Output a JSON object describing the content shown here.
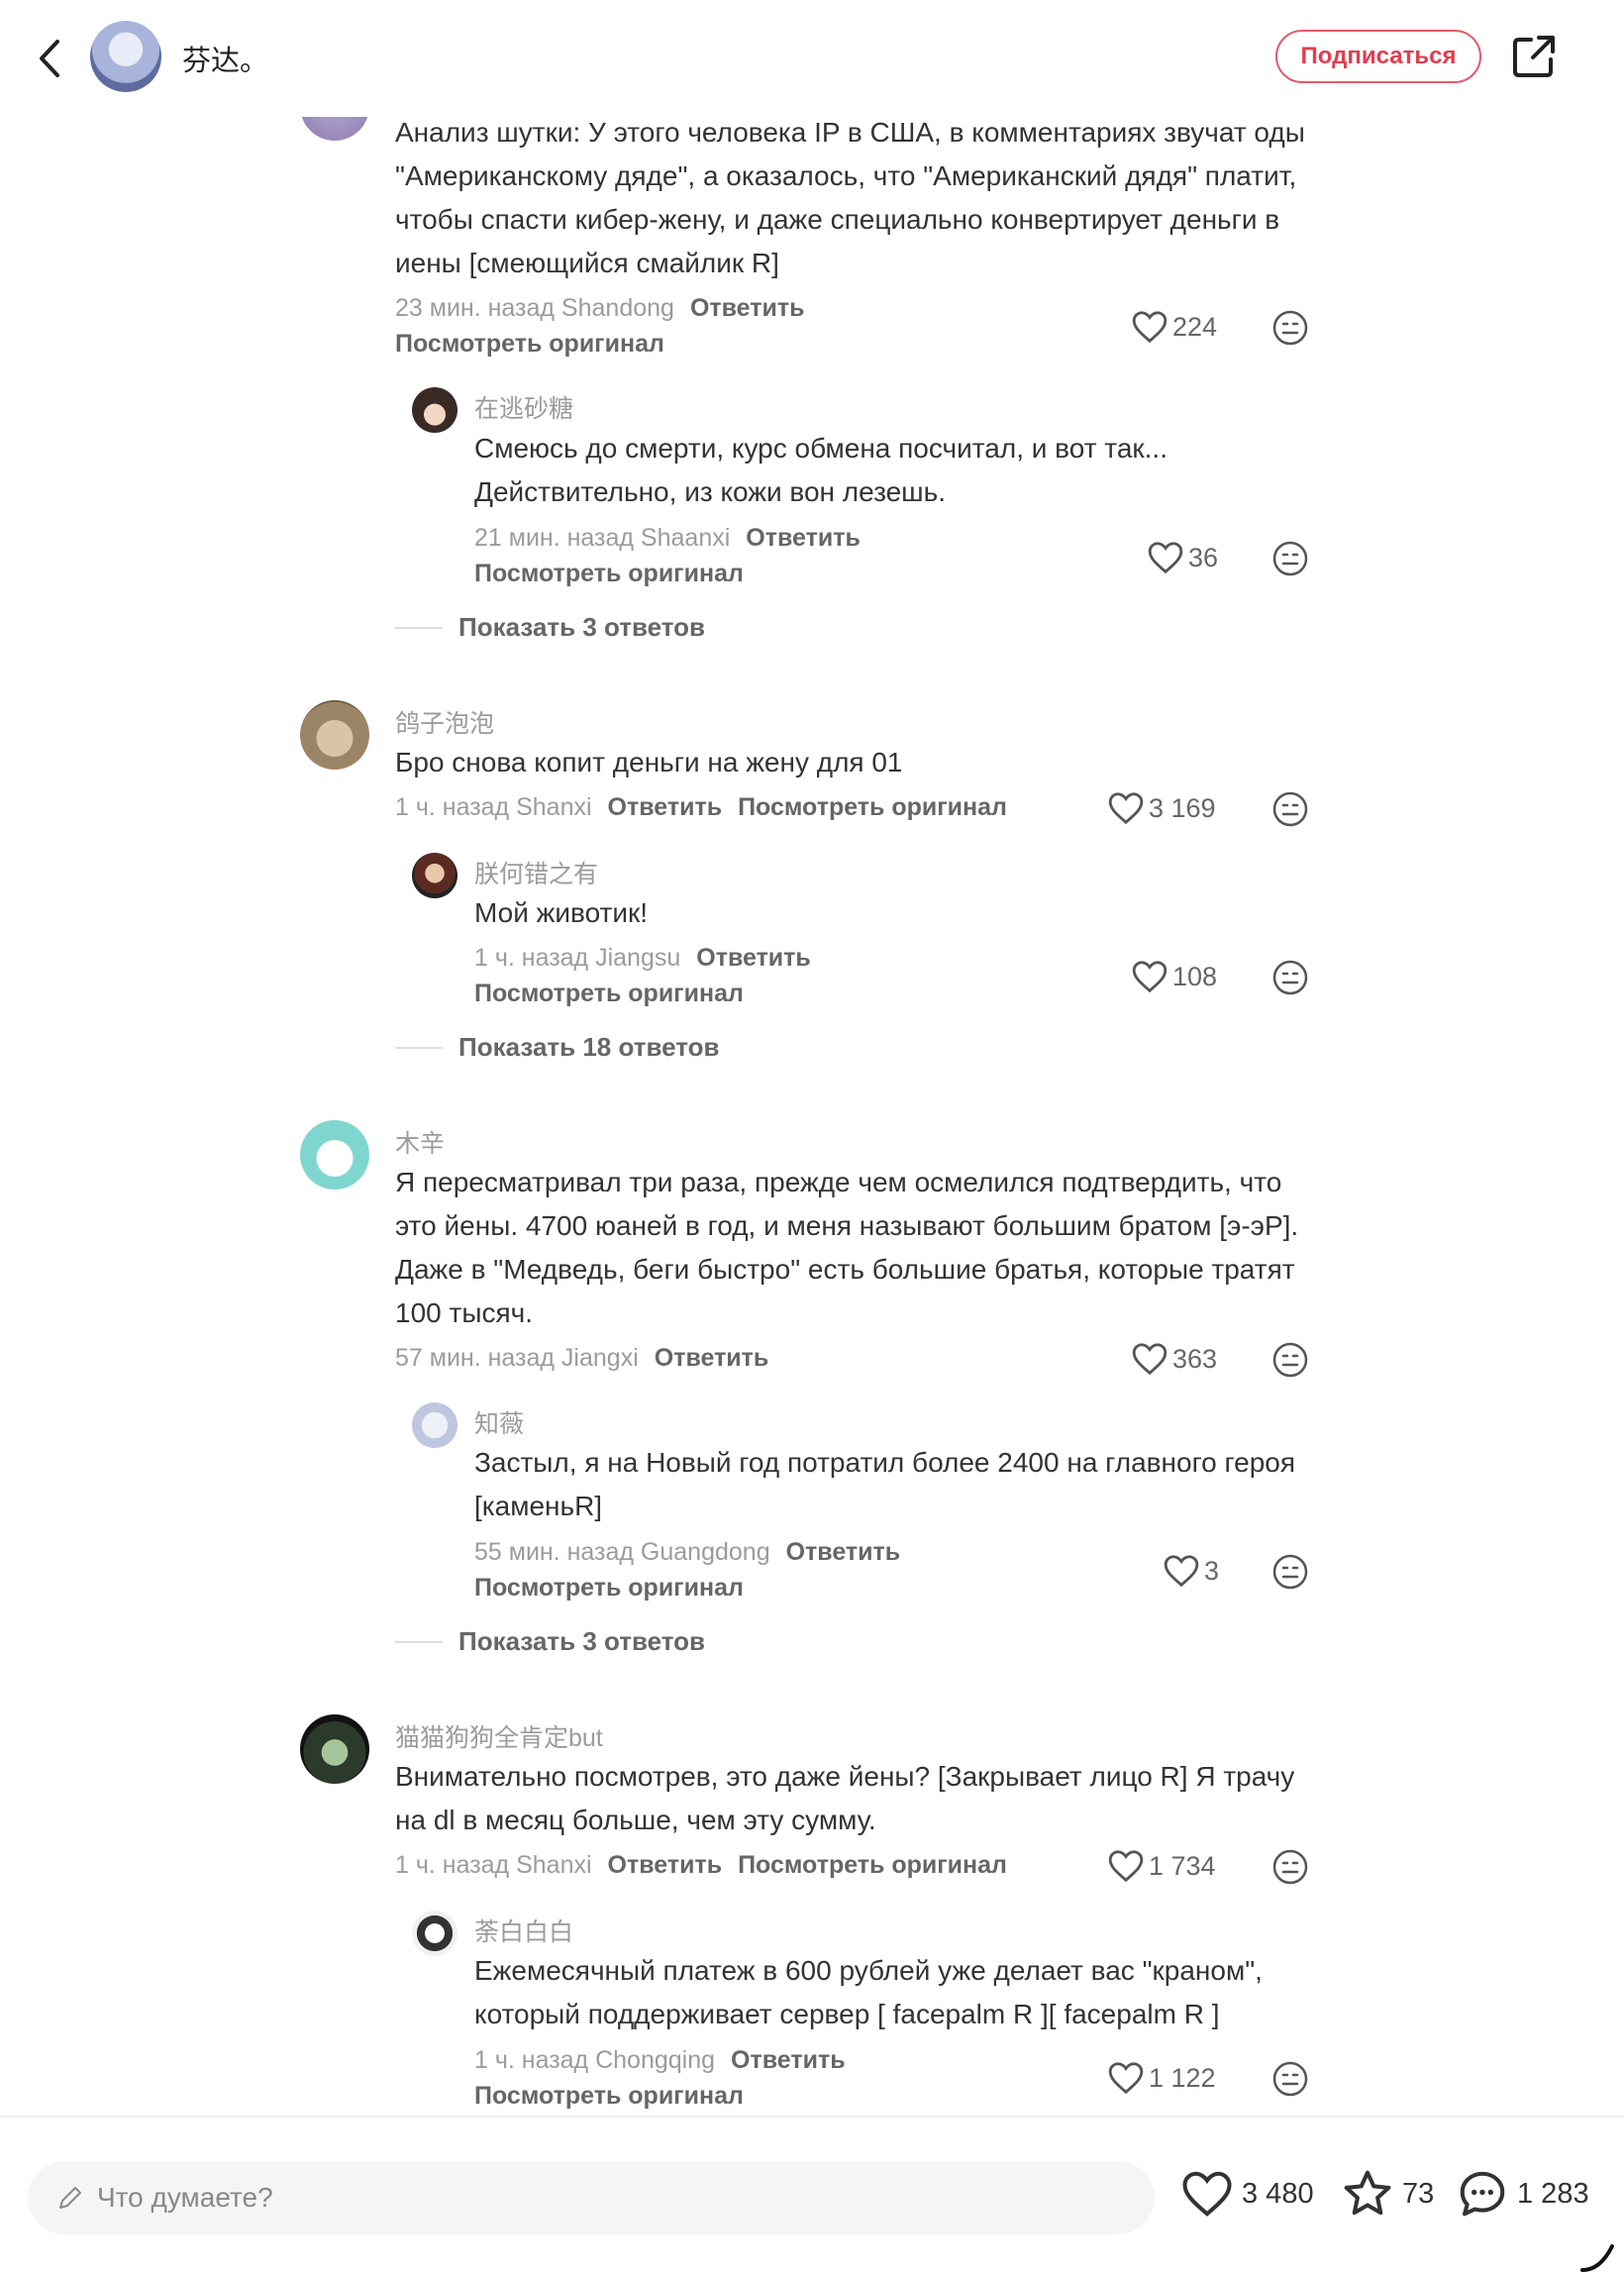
{
  "header": {
    "author_name": "芬达。",
    "subscribe_label": "Подписаться"
  },
  "comments": [
    {
      "text": "Анализ шутки: У этого человека IP в США, в комментариях звучат оды \"Американскому дяде\", а оказалось, что \"Американский дядя\" платит, чтобы спасти кибер-жену, и даже специально конвертирует деньги в иены [смеющийся смайлик R]",
      "time_location": "23 мин. назад Shandong",
      "reply_label": "Ответить",
      "view_original": "Посмотреть оригинал",
      "likes": "224",
      "replies": [
        {
          "author": "在逃砂糖",
          "text": "Смеюсь до смерти, курс обмена посчитал, и вот так... Действительно, из кожи вон лезешь.",
          "time_location": "21 мин. назад Shaanxi",
          "reply_label": "Ответить",
          "view_original": "Посмотреть оригинал",
          "likes": "36"
        }
      ],
      "show_replies": "Показать 3 ответов"
    },
    {
      "author": "鸽子泡泡",
      "text": "Бро снова копит деньги на жену для 01",
      "time_location": "1 ч. назад Shanxi",
      "reply_label": "Ответить",
      "view_original": "Посмотреть оригинал",
      "likes": "3 169",
      "replies": [
        {
          "author": "朕何错之有",
          "text": "Мой животик!",
          "time_location": "1 ч. назад Jiangsu",
          "reply_label": "Ответить",
          "view_original": "Посмотреть оригинал",
          "likes": "108"
        }
      ],
      "show_replies": "Показать 18 ответов"
    },
    {
      "author": "木辛",
      "text": "Я пересматривал три раза, прежде чем осмелился подтвердить, что это йены. 4700 юаней в год, и меня называют большим братом [э-эР]. Даже в \"Медведь, беги быстро\" есть большие братья, которые тратят 100 тысяч.",
      "time_location": "57 мин. назад Jiangxi",
      "reply_label": "Ответить",
      "likes": "363",
      "replies": [
        {
          "author": "知薇",
          "text": "Застыл, я на Новый год потратил более 2400 на главного героя [каменьR]",
          "time_location": "55 мин. назад Guangdong",
          "reply_label": "Ответить",
          "view_original": "Посмотреть оригинал",
          "likes": "3"
        }
      ],
      "show_replies": "Показать 3 ответов"
    },
    {
      "author": "猫猫狗狗全肯定but",
      "text": "Внимательно посмотрев, это даже йены? [Закрывает лицо R] Я трачу на dl в месяц больше, чем эту сумму.",
      "time_location": "1 ч. назад Shanxi",
      "reply_label": "Ответить",
      "view_original": "Посмотреть оригинал",
      "likes": "1 734",
      "replies": [
        {
          "author": "荼白白白",
          "text": "Ежемесячный платеж в 600 рублей уже делает вас \"краном\", который поддерживает сервер [ facepalm R ][ facepalm R ]",
          "time_location": "1 ч. назад Chongqing",
          "reply_label": "Ответить",
          "view_original": "Посмотреть оригинал",
          "likes": "1 122"
        }
      ]
    }
  ],
  "bottom_bar": {
    "input_placeholder": "Что думаете?",
    "likes": "3 480",
    "favorites": "73",
    "comments": "1 283"
  },
  "colors": {
    "accent": "#e33c50",
    "text": "#333333",
    "muted": "#9b9b9b"
  }
}
